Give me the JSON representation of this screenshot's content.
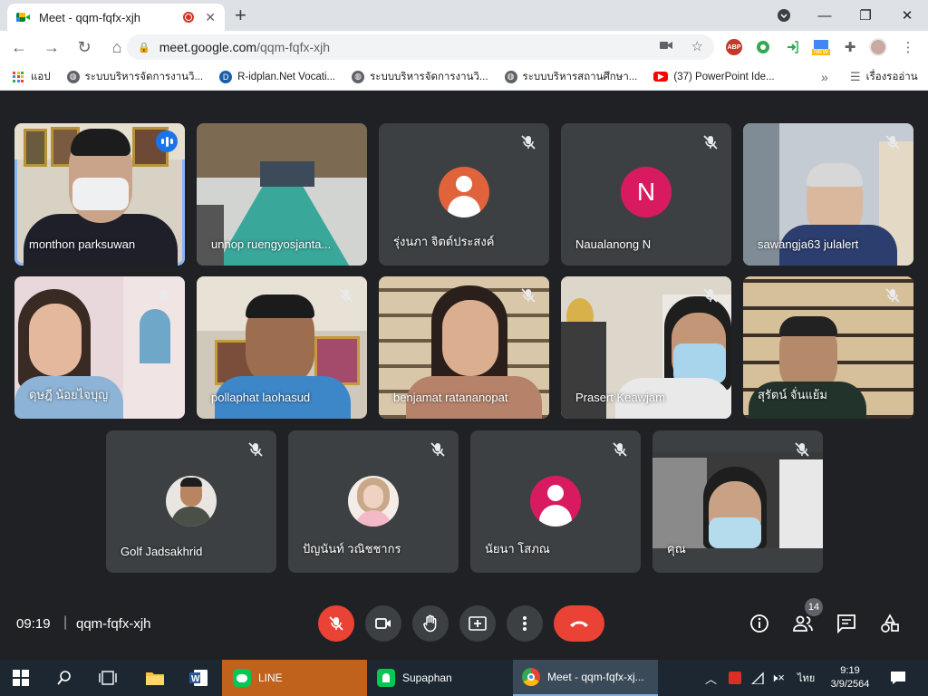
{
  "browser": {
    "tab_title": "Meet - qqm-fqfx-xjh",
    "url_host": "meet.google.com",
    "url_path": "/qqm-fqfx-xjh",
    "ext_new_badge": "NEW",
    "ext_abp": "ABP"
  },
  "bookmarks": {
    "apps": "แอป",
    "items": [
      {
        "label": "ระบบบริหารจัดการงานวิ...",
        "icon": "globe-icon"
      },
      {
        "label": "R-idplan.Net Vocati...",
        "icon": "r-idplan-icon"
      },
      {
        "label": "ระบบบริหารจัดการงานวิ...",
        "icon": "globe-icon"
      },
      {
        "label": "ระบบบริหารสถานศึกษา...",
        "icon": "globe-icon"
      },
      {
        "label": "(37) PowerPoint Ide...",
        "icon": "youtube-icon"
      }
    ],
    "more": "»",
    "reading_list": "เรื่องรออ่าน"
  },
  "participants": [
    {
      "name": "monthon parksuwan",
      "type": "video",
      "speaking": true
    },
    {
      "name": "unnop ruengyosjanta...",
      "type": "video",
      "muted": false
    },
    {
      "name": "รุ่งนภา จิตต์ประสงค์",
      "type": "avatar",
      "avatar_color": "#e0633c",
      "muted": true
    },
    {
      "name": "Naualanong N",
      "type": "letter",
      "letter": "N",
      "avatar_color": "#d81b60",
      "muted": true
    },
    {
      "name": "sawangja63 julalert",
      "type": "video",
      "muted": true
    },
    {
      "name": "ดุษฎี น้อยไจบุญ",
      "type": "video",
      "muted": true
    },
    {
      "name": "pollaphat laohasud",
      "type": "video",
      "muted": true
    },
    {
      "name": "benjamat ratananopat",
      "type": "video",
      "muted": true
    },
    {
      "name": "Prasert Keawjam",
      "type": "video",
      "muted": true
    },
    {
      "name": "สุรัตน์ จั่นแย้ม",
      "type": "video",
      "muted": true
    },
    {
      "name": "Golf Jadsakhrid",
      "type": "photo",
      "muted": true
    },
    {
      "name": "ปัญนันท์ วณิชชากร",
      "type": "photo",
      "muted": true
    },
    {
      "name": "นัยนา โสภณ",
      "type": "avatar",
      "avatar_color": "#d81b60",
      "muted": true
    },
    {
      "name": "คุณ",
      "type": "video",
      "muted": true
    }
  ],
  "meeting": {
    "time": "09:19",
    "separator": "|",
    "code": "qqm-fqfx-xjh",
    "participant_count": "14"
  },
  "taskbar": {
    "apps": [
      {
        "label": "LINE",
        "icon": "line-icon"
      },
      {
        "label": "Supaphan",
        "icon": "line-icon"
      },
      {
        "label": "Meet - qqm-fqfx-xj...",
        "icon": "chrome-icon"
      }
    ],
    "lang": "ไทย",
    "time": "9:19",
    "date": "3/9/2564"
  },
  "colors": {
    "meet_bg": "#202124",
    "tile_bg": "#3c4043",
    "red": "#ea4335",
    "active_outline": "#8ab4f8",
    "taskbar": "#1c2732"
  }
}
